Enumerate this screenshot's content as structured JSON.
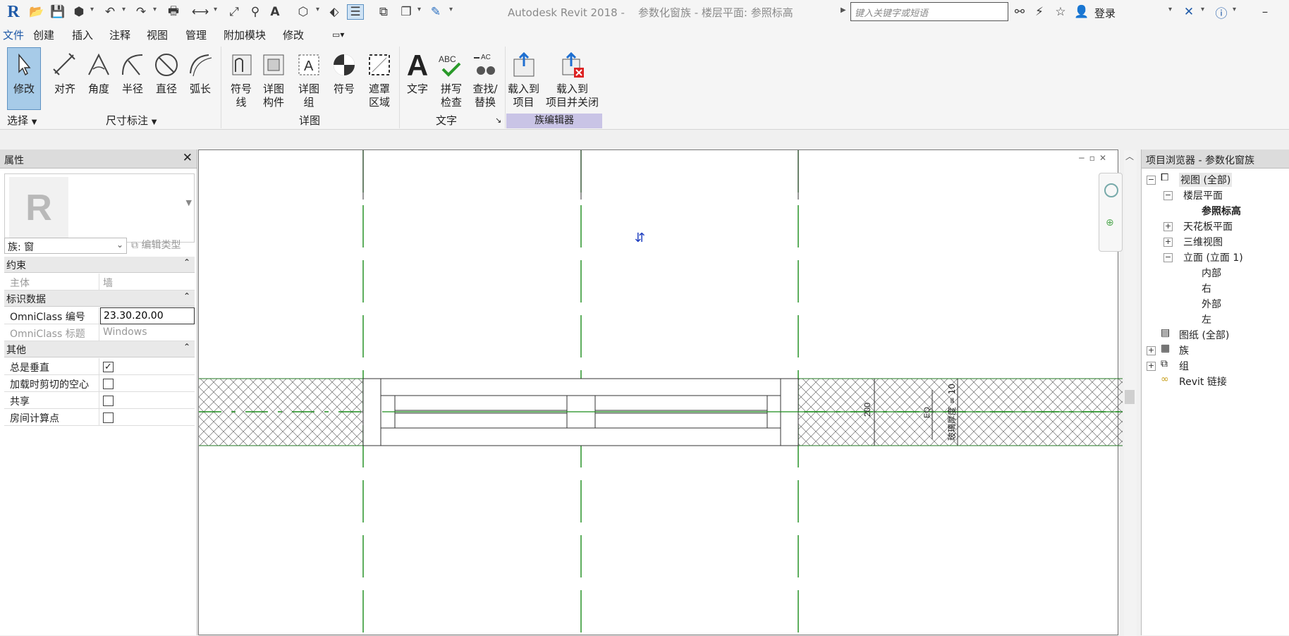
{
  "app": {
    "title": "Autodesk Revit 2018 -",
    "doc_title": "参数化窗族 - 楼层平面: 参照标高",
    "search_placeholder": "键入关键字或短语",
    "login": "登录",
    "logo": "R"
  },
  "menu": [
    "文件",
    "创建",
    "插入",
    "注释",
    "视图",
    "管理",
    "附加模块",
    "修改"
  ],
  "active_tab": "注释",
  "ribbon": {
    "buttons": [
      {
        "id": "modify",
        "label": "修改"
      },
      {
        "id": "align",
        "label": "对齐"
      },
      {
        "id": "angle",
        "label": "角度"
      },
      {
        "id": "radius",
        "label": "半径"
      },
      {
        "id": "diameter",
        "label": "直径"
      },
      {
        "id": "arc",
        "label": "弧长"
      },
      {
        "id": "symbol-line",
        "label": "符号\n线"
      },
      {
        "id": "detail-component",
        "label": "详图\n构件"
      },
      {
        "id": "detail-group",
        "label": "详图\n组"
      },
      {
        "id": "symbol",
        "label": "符号"
      },
      {
        "id": "masking-region",
        "label": "遮罩\n区域"
      },
      {
        "id": "text",
        "label": "文字"
      },
      {
        "id": "spell-check",
        "label": "拼写\n检查"
      },
      {
        "id": "find-replace",
        "label": "查找/\n替换"
      },
      {
        "id": "load-into-project",
        "label": "载入到\n项目"
      },
      {
        "id": "load-into-project-close",
        "label": "载入到\n项目并关闭"
      }
    ],
    "panels": {
      "select": "选择",
      "dimension": "尺寸标注",
      "detail": "详图",
      "text": "文字",
      "family_editor": "族编辑器"
    }
  },
  "properties": {
    "title": "属性",
    "family": "族: 窗",
    "edit_type": "编辑类型",
    "sections": {
      "constraints": "约束",
      "identity": "标识数据",
      "other": "其他"
    },
    "rows": {
      "host": {
        "label": "主体",
        "value": "墙"
      },
      "omniclass_number": {
        "label": "OmniClass 编号",
        "value": "23.30.20.00"
      },
      "omniclass_title": {
        "label": "OmniClass 标题",
        "value": "Windows"
      },
      "always_vertical": {
        "label": "总是垂直",
        "checked": true
      },
      "cut_void": {
        "label": "加载时剪切的空心",
        "checked": false
      },
      "shared": {
        "label": "共享",
        "checked": false
      },
      "room_calc": {
        "label": "房间计算点",
        "checked": false
      }
    }
  },
  "canvas": {
    "dim_200": "200",
    "dim_eq": "EQ",
    "dim_glass": "玻璃厚度 = 10"
  },
  "browser": {
    "title": "项目浏览器 - 参数化窗族",
    "nodes": {
      "views": "视图 (全部)",
      "floor_plans": "楼层平面",
      "ref_level": "参照标高",
      "ceiling_plans": "天花板平面",
      "views_3d": "三维视图",
      "elevations": "立面 (立面 1)",
      "interior": "内部",
      "right": "右",
      "exterior": "外部",
      "left": "左",
      "sheets": "图纸 (全部)",
      "families": "族",
      "groups": "组",
      "revit_links": "Revit 链接"
    }
  },
  "colors": {
    "brand": "#1f5aa8",
    "selected": "#a7cbe8",
    "family_editor": "#c9c4e6",
    "centerline": "#1a8c1a"
  }
}
